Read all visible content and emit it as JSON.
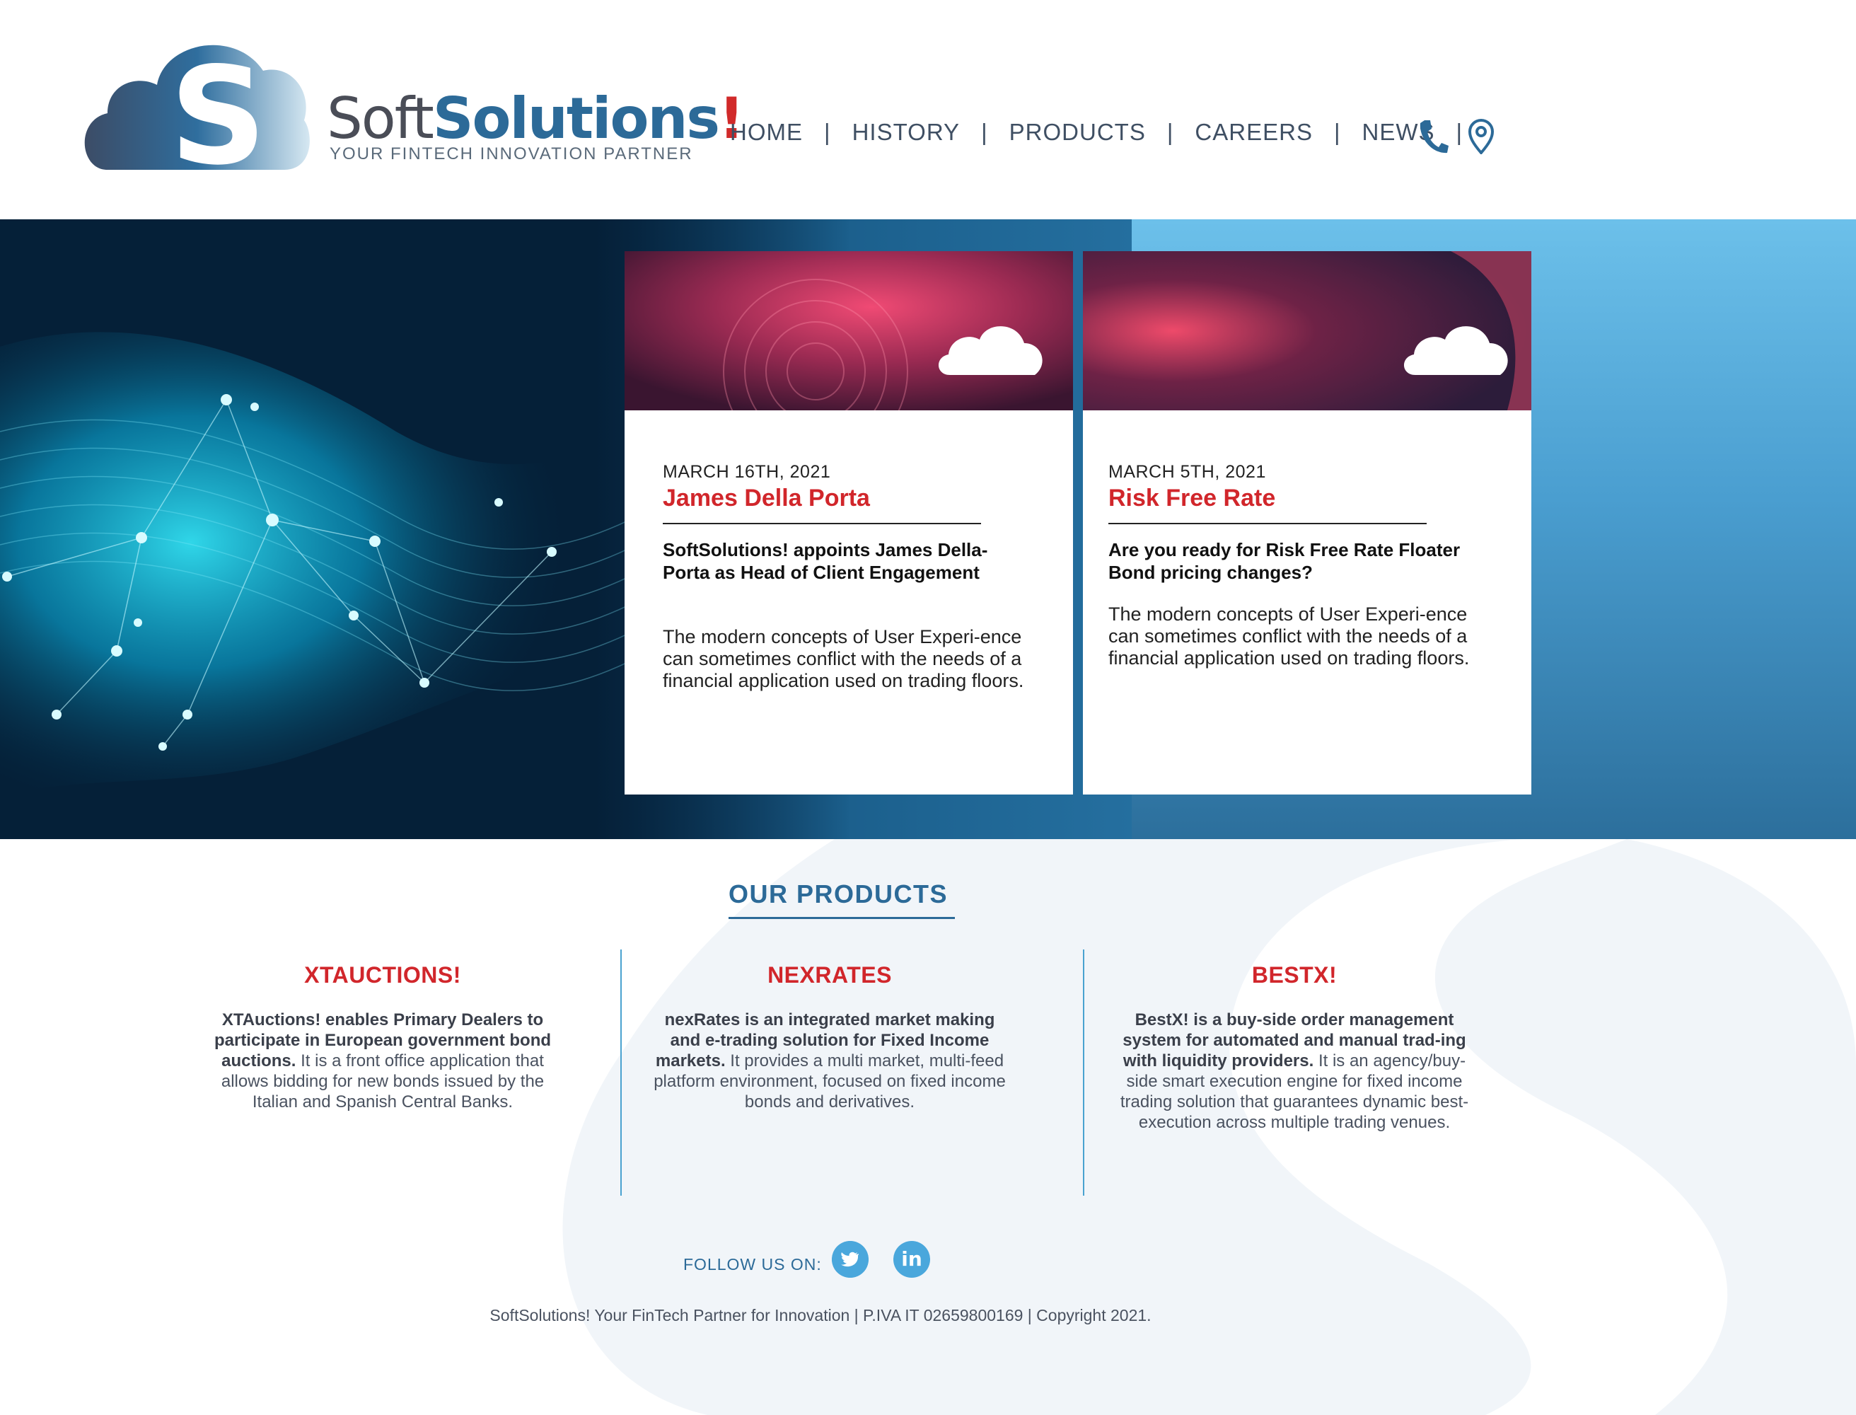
{
  "header": {
    "brand": {
      "soft": "Soft",
      "solutions": "Solutions",
      "bang": "!"
    },
    "tagline": "YOUR FINTECH INNOVATION PARTNER",
    "nav": [
      "HOME",
      "HISTORY",
      "PRODUCTS",
      "CAREERS",
      "NEWS"
    ],
    "separator": "|",
    "icons": [
      "phone-icon",
      "location-pin-icon"
    ]
  },
  "news": [
    {
      "date": "MARCH 16TH, 2021",
      "title": "James Della Porta",
      "lead": "SoftSolutions! appoints James Della-Porta as Head of Client Engagement",
      "body": "The modern concepts of User Experi-ence can sometimes conflict with the needs of a financial application used on trading floors."
    },
    {
      "date": "MARCH 5TH, 2021",
      "title": "Risk Free Rate",
      "lead": "Are you ready for Risk Free Rate Floater Bond pricing changes?",
      "body": "The modern concepts of User Experi-ence can sometimes conflict with the needs of a financial application used on trading floors."
    }
  ],
  "products": {
    "heading": "OUR PRODUCTS",
    "items": [
      {
        "name": "XTAUCTIONS!",
        "lead": "XTAuctions! enables Primary Dealers to participate in European government bond auctions.",
        "text": " It is a front office application that allows bidding for new bonds issued by the Italian and Spanish Central Banks."
      },
      {
        "name": "NEXRATES",
        "lead": "nexRates is an integrated market making and e-trading solution for Fixed Income markets.",
        "text": " It provides a multi market, multi-feed platform environment, focused on fixed income bonds and derivatives."
      },
      {
        "name": "BESTX!",
        "lead": "BestX! is a buy-side order management system for automated and manual trad-ing with liquidity providers.",
        "text": " It is an agency/buy-side smart execution engine for fixed income trading solution that guarantees dynamic best-execution across multiple trading venues."
      }
    ]
  },
  "footer": {
    "follow_label": "FOLLOW US ON:",
    "social": [
      "twitter-icon",
      "linkedin-icon"
    ],
    "linkedin_text": "in",
    "copyright": "SoftSolutions! Your FinTech Partner for Innovation | P.IVA IT 02659800169 | Copyright 2021."
  },
  "colors": {
    "brand_blue": "#2c6a98",
    "accent_red": "#d1262b",
    "social_blue": "#4aa7dc",
    "divider_blue": "#4aa2d0"
  }
}
